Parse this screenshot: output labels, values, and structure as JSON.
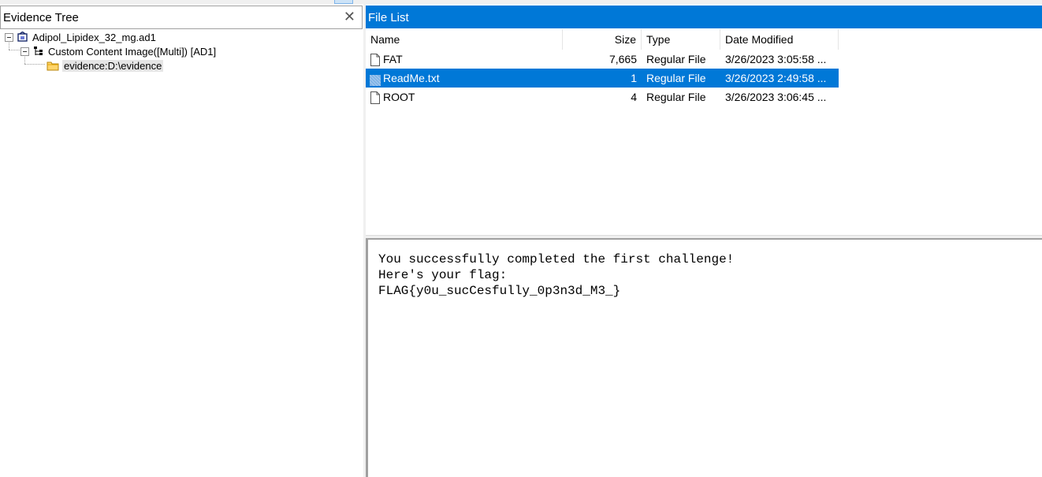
{
  "colors": {
    "accent": "#0078d7",
    "selected_text": "#ffffff",
    "border": "#a0a0a0"
  },
  "evidence_tree": {
    "title": "Evidence Tree",
    "close_icon": "close-icon",
    "nodes": [
      {
        "label": "Adipol_Lipidex_32_mg.ad1",
        "icon": "evidence-container-icon"
      },
      {
        "label": "Custom Content Image([Multi]) [AD1]",
        "icon": "image-tree-icon"
      },
      {
        "label": "evidence:D:\\evidence",
        "icon": "folder-icon"
      }
    ]
  },
  "file_list": {
    "title": "File List",
    "columns": [
      "Name",
      "Size",
      "Type",
      "Date Modified"
    ],
    "rows": [
      {
        "name": "FAT",
        "size": "7,665",
        "type": "Regular File",
        "date": "3/26/2023 3:05:58 ...",
        "icon": "file-icon"
      },
      {
        "name": "ReadMe.txt",
        "size": "1",
        "type": "Regular File",
        "date": "3/26/2023 2:49:58 ...",
        "icon": "text-file-icon"
      },
      {
        "name": "ROOT",
        "size": "4",
        "type": "Regular File",
        "date": "3/26/2023 3:06:45 ...",
        "icon": "file-icon"
      }
    ],
    "selected_row": "ReadMe.txt"
  },
  "viewer": {
    "lines": [
      "You successfully completed the first challenge!",
      "Here's your flag:",
      "FLAG{y0u_sucCesfully_0p3n3d_M3_}"
    ]
  }
}
